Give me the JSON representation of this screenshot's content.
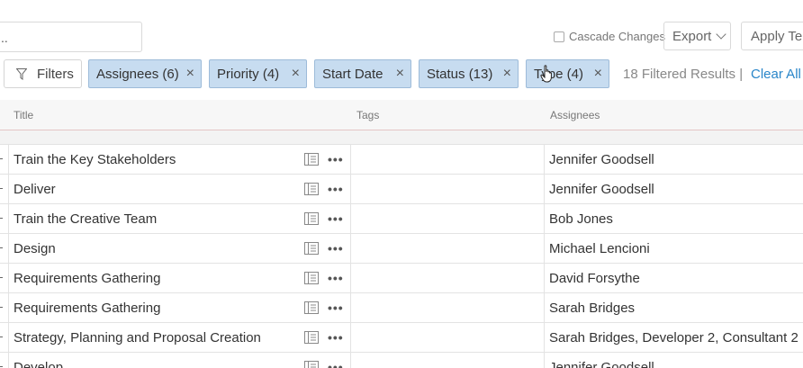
{
  "search": {
    "value": ".."
  },
  "cascade_label": "Cascade Changes",
  "export_label": "Export",
  "apply_label": "Apply Ter",
  "filters_label": "Filters",
  "chips": [
    {
      "label": "Assignees (6)"
    },
    {
      "label": "Priority (4)"
    },
    {
      "label": "Start Date"
    },
    {
      "label": "Status (13)"
    },
    {
      "label": "Type (4)"
    }
  ],
  "close_glyph": "×",
  "filtered_results": "18 Filtered Results  |",
  "clear_all": "Clear All",
  "columns": {
    "title": "Title",
    "tags": "Tags",
    "assignees": "Assignees"
  },
  "rows": [
    {
      "title": "Train the Key Stakeholders",
      "assignees": "Jennifer Goodsell"
    },
    {
      "title": "Deliver",
      "assignees": "Jennifer Goodsell"
    },
    {
      "title": "Train the Creative Team",
      "assignees": "Bob Jones"
    },
    {
      "title": "Design",
      "assignees": "Michael Lencioni"
    },
    {
      "title": "Requirements Gathering",
      "assignees": "David Forsythe"
    },
    {
      "title": "Requirements Gathering",
      "assignees": "Sarah Bridges"
    },
    {
      "title": "Strategy, Planning and Proposal Creation",
      "assignees": "Sarah Bridges, Developer 2, Consultant 2"
    },
    {
      "title": "Develop",
      "assignees": "Jennifer Goodsell"
    }
  ],
  "more_glyph": "•••"
}
